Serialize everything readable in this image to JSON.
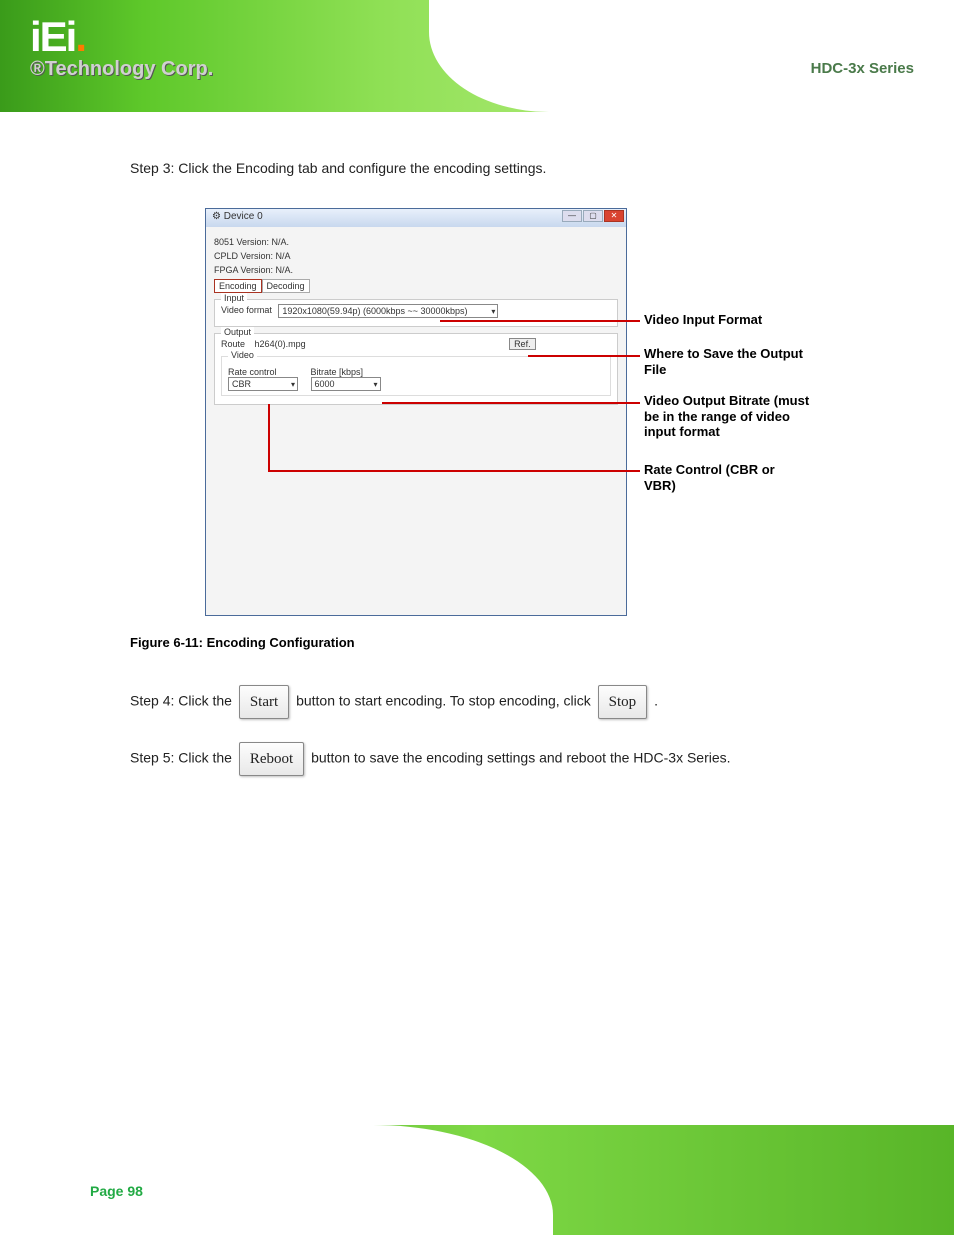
{
  "logo": {
    "brand": "iEi",
    "sub": "®Technology Corp."
  },
  "product": "HDC-3x Series",
  "steps": {
    "s3": "Step 3: Click the Encoding tab and configure the encoding settings.",
    "s4_a": "Step 4: Click the ",
    "s4_b": " button to start encoding. To stop encoding, click ",
    "s4_c": ".",
    "s5_a": "Step 5: Click the ",
    "s5_b": " button to save the encoding settings and reboot the HDC-3x Series."
  },
  "buttons": {
    "start": "Start",
    "stop": "Stop",
    "reboot": "Reboot"
  },
  "window": {
    "title": "Device 0",
    "info": {
      "v8051": "8051 Version: N/A.",
      "cpld": "CPLD Version: N/A",
      "fpga": "FPGA Version: N/A."
    },
    "tabs": {
      "enc": "Encoding",
      "dec": "Decoding"
    },
    "input": {
      "group": "Input",
      "vf_label": "Video format",
      "vf_value": "1920x1080(59.94p)   (6000kbps ~~ 30000kbps)"
    },
    "output": {
      "group": "Output",
      "route_label": "Route",
      "route_value": "h264(0).mpg",
      "ref": "Ref.",
      "video": "Video",
      "rc_label": "Rate control",
      "rc_value": "CBR",
      "br_label": "Bitrate [kbps]",
      "br_value": "6000"
    }
  },
  "callouts": {
    "c1": "Video Input Format",
    "c2": "Where to Save the Output File",
    "c3": "Video Output Bitrate (must be in the range of  video input format",
    "c4": "Rate Control (CBR or VBR)"
  },
  "figure": "Figure 6-11: Encoding Configuration",
  "page": "Page 98"
}
